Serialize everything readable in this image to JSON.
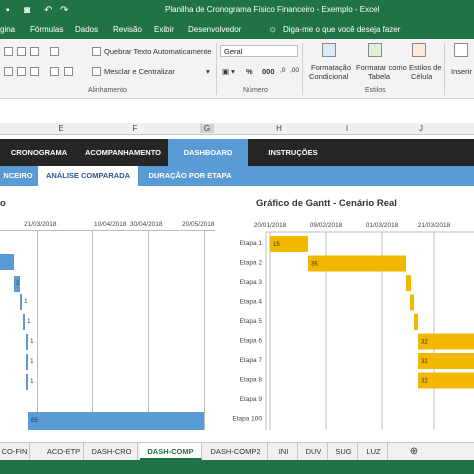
{
  "window": {
    "title": "Planilha de Cronograma Físico Financeiro - Exemplo  -  Excel"
  },
  "ribbon_tabs": [
    "gina",
    "Fórmulas",
    "Dados",
    "Revisão",
    "Exibir",
    "Desenvolvedor"
  ],
  "tell_me": "Diga-me o que você deseja fazer",
  "ribbon": {
    "wrap_text": "Quebrar Texto Automaticamente",
    "merge_center": "Mesclar e Centralizar",
    "number_format": "Geral",
    "conditional_formatting": [
      "Formatação",
      "Condicional"
    ],
    "format_as_table": [
      "Formatar como",
      "Tabela"
    ],
    "cell_styles": [
      "Estilos de",
      "Célula"
    ],
    "insert": "Inserir",
    "group_alignment": "Alinhamento",
    "group_number": "Número",
    "group_styles": "Estilos"
  },
  "columns": [
    "E",
    "F",
    "G",
    "H",
    "I",
    "J"
  ],
  "nav_tabs": [
    "CRONOGRAMA",
    "ACOMPANHAMENTO",
    "DASHBOARD",
    "INSTRUÇÕES"
  ],
  "sub_tabs": [
    "NCEIRO",
    "ANÁLISE COMPARADA",
    "DURAÇÃO POR ETAPA"
  ],
  "left_chart": {
    "title_fragment": "o",
    "dates": [
      "21/03/2018",
      "10/04/2018",
      "30/04/2018",
      "20/05/2018"
    ],
    "values": [
      "2",
      "1",
      "1",
      "1",
      "1",
      "1",
      "65"
    ]
  },
  "chart_data": {
    "type": "bar",
    "title": "Gráfico de Gantt - Cenário Real",
    "x_ticks": [
      "20/01/2018",
      "09/02/2018",
      "01/03/2018",
      "21/03/2018"
    ],
    "categories": [
      "Etapa 1",
      "Etapa 2",
      "Etapa 3",
      "Etapa 4",
      "Etapa 5",
      "Etapa 6",
      "Etapa 7",
      "Etapa 8",
      "Etapa 9",
      "Etapa 100"
    ],
    "labels": [
      "15",
      "36",
      "",
      "",
      "",
      "32",
      "32",
      "32",
      "",
      ""
    ],
    "color": "#f2b800"
  },
  "sheet_tabs": [
    "CO-FIN",
    "ACO-ETP",
    "DASH-CRO",
    "DASH-COMP",
    "DASH-COMP2",
    "INI",
    "DUV",
    "SUG",
    "LUZ"
  ],
  "add_sheet": "⊕"
}
